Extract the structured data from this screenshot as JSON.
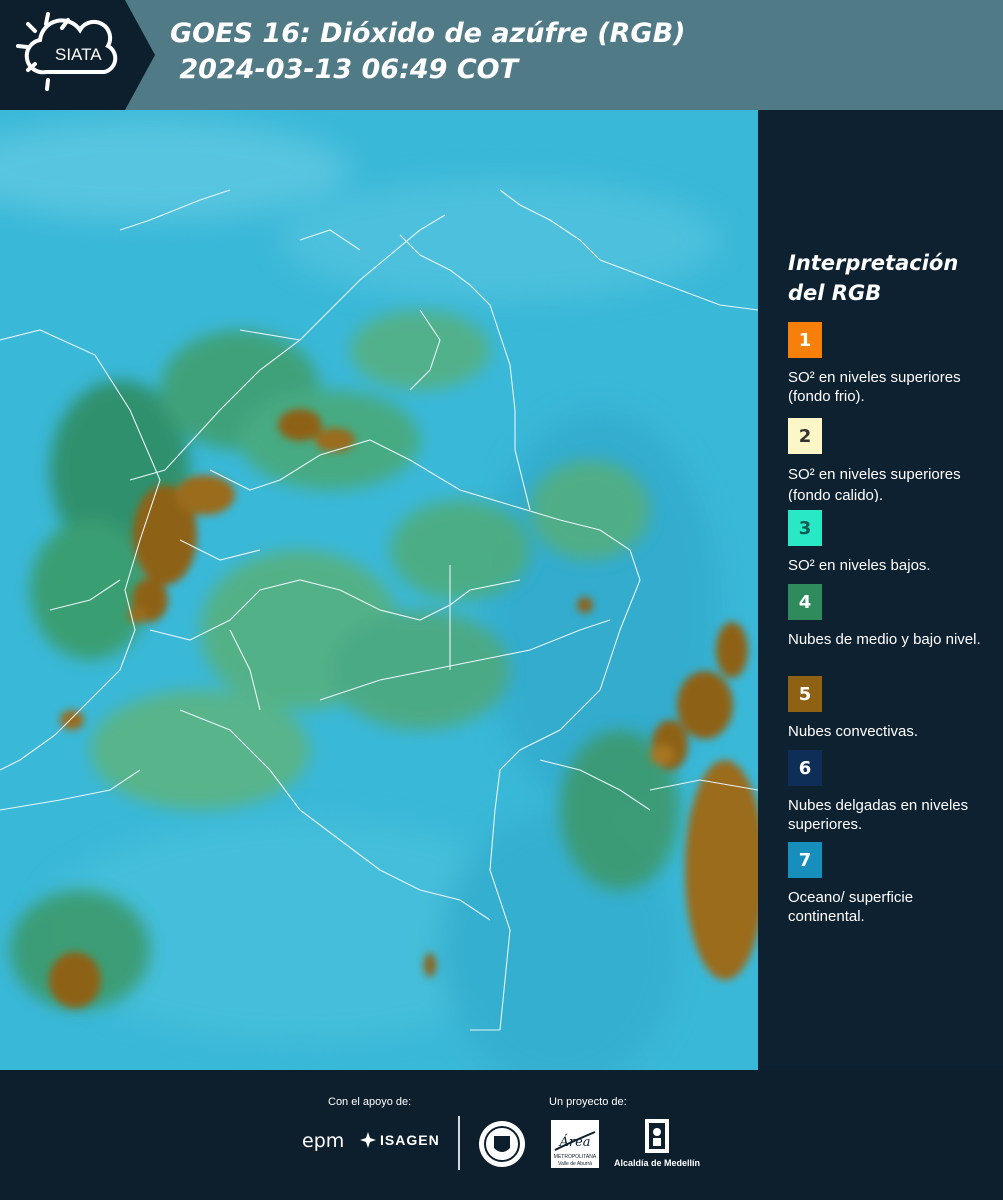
{
  "header": {
    "brand": "SIATA",
    "title_line1": "GOES 16: Dióxido de azúfre (RGB)",
    "title_line2": " 2024-03-13 06:49 COT"
  },
  "legend": {
    "title_line1": "Interpretación",
    "title_line2": "del RGB",
    "items": [
      {
        "number": "1",
        "color": "#f7800a",
        "label": "SO² en niveles superiores (fondo frio)."
      },
      {
        "number": "2",
        "color": "#fdf7c7",
        "label": "SO² en niveles superiores (fondo calido)."
      },
      {
        "number": "3",
        "color": "#28e8c6",
        "label": "SO² en niveles bajos."
      },
      {
        "number": "4",
        "color": "#2f8a5c",
        "label": "Nubes de medio y bajo nivel."
      },
      {
        "number": "5",
        "color": "#8e6212",
        "label": "Nubes convectivas."
      },
      {
        "number": "6",
        "color": "#0f2e57",
        "label": "Nubes delgadas en niveles superiores."
      },
      {
        "number": "7",
        "color": "#168fbd",
        "label": "Oceano/ superficie continental."
      }
    ]
  },
  "footer": {
    "support_label": "Con el apoyo de:",
    "project_label": "Un proyecto de:",
    "sponsors": [
      "epm",
      "ISAGEN"
    ],
    "area_name": "Área",
    "area_sub1": "METROPOLITANA",
    "area_sub2": "Valle de Aburrá",
    "alcaldia": "Alcaldía de Medellín"
  },
  "colors": {
    "header_bg": "#4f7a86",
    "panel_bg": "#0e2130",
    "map_base": "#3ab8d8"
  }
}
